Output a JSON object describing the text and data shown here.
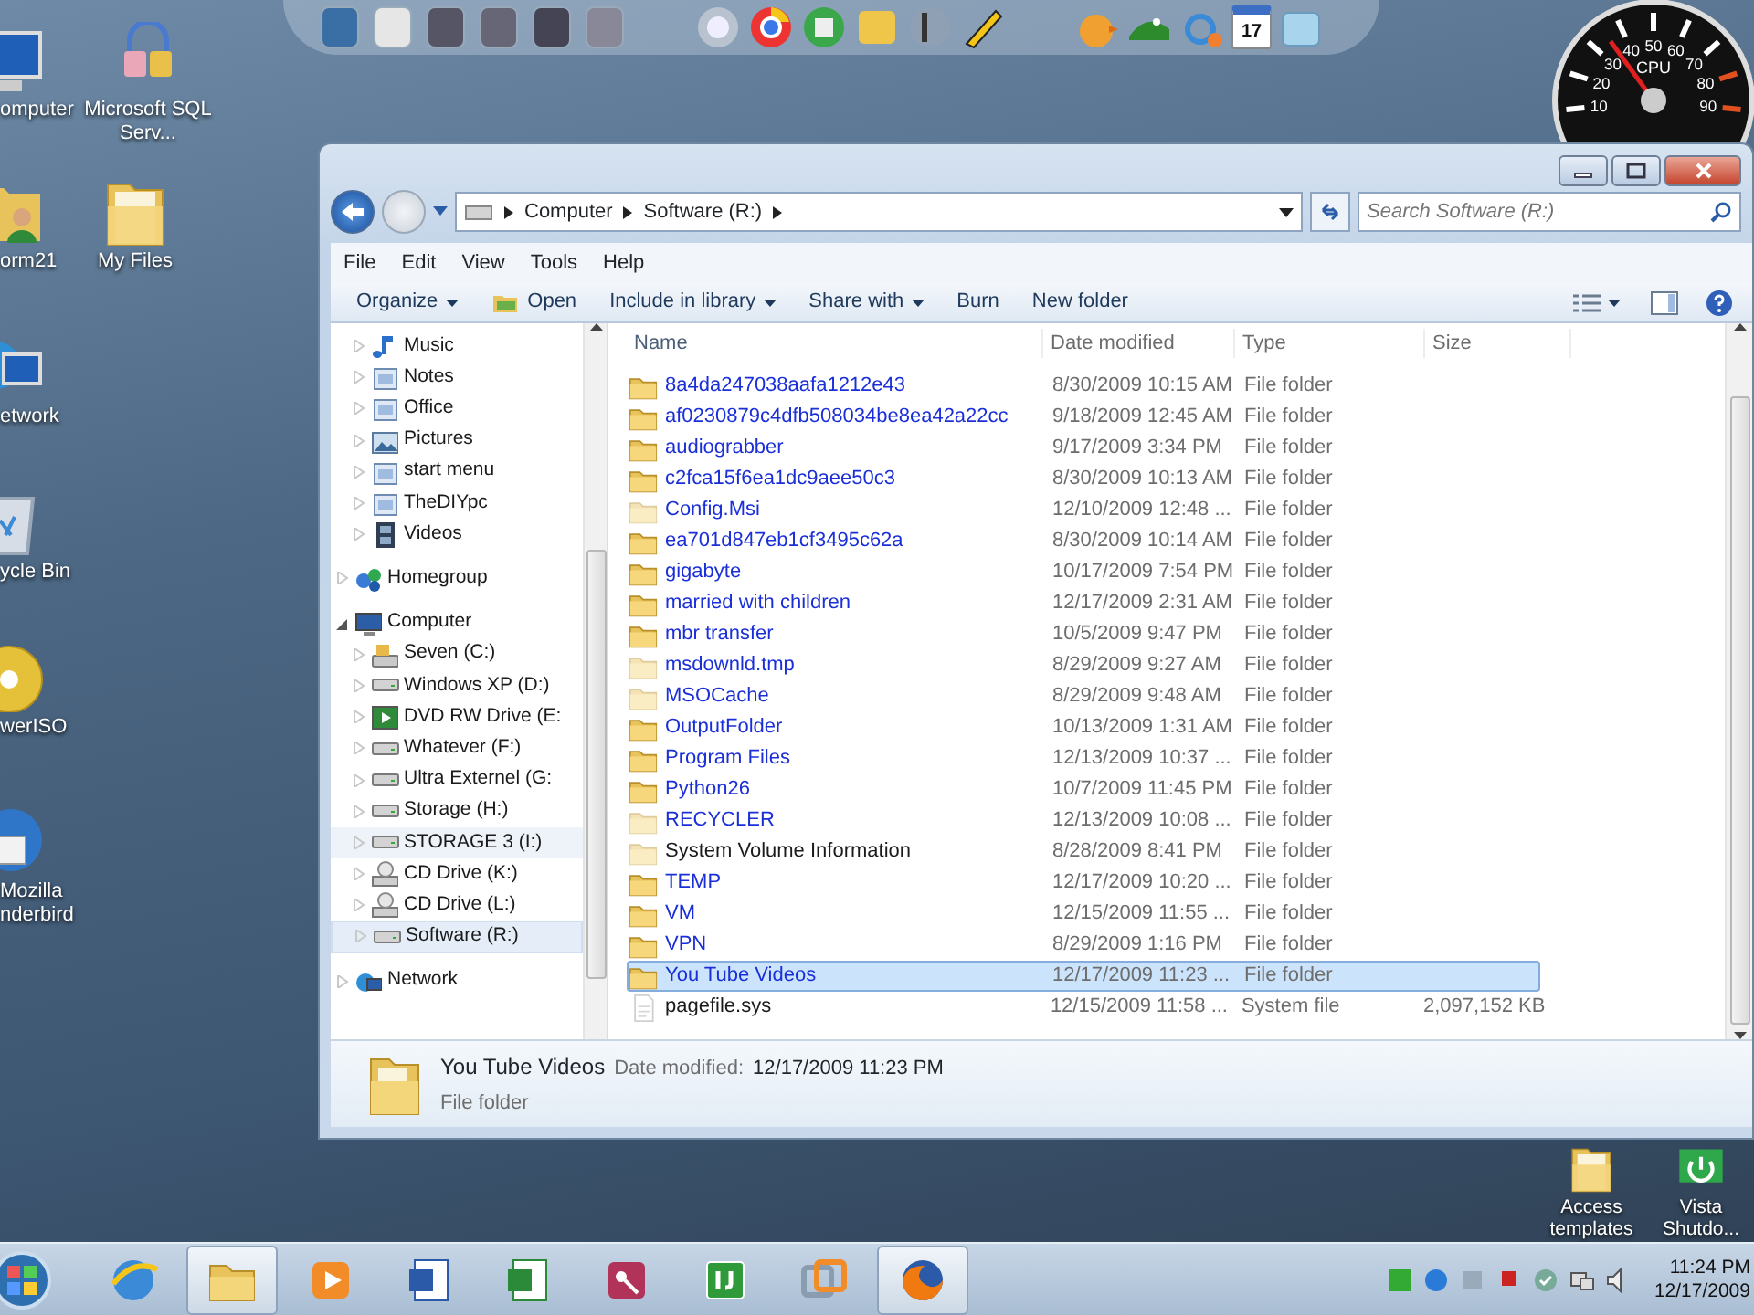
{
  "desktop": {
    "icons": [
      {
        "label": "omputer",
        "kind": "computer"
      },
      {
        "label": "Microsoft SQL Serv...",
        "kind": "database"
      },
      {
        "label": "orm21",
        "kind": "userfolder"
      },
      {
        "label": "My Files",
        "kind": "folder"
      },
      {
        "label": "etwork",
        "kind": "network"
      },
      {
        "label": "ycle Bin",
        "kind": "bin"
      },
      {
        "label": "werISO",
        "kind": "disc"
      },
      {
        "label": "Mozilla nderbird",
        "kind": "mail"
      },
      {
        "label": "Access templates",
        "kind": "folder"
      },
      {
        "label": "Vista Shutdo...",
        "kind": "shutdown"
      }
    ]
  },
  "dock": {
    "calendar_day": "17"
  },
  "cpu_gauge": {
    "label": "CPU",
    "ticks": [
      "10",
      "20",
      "30",
      "40",
      "50",
      "60",
      "70",
      "80",
      "90"
    ],
    "level": 0.35
  },
  "window": {
    "address": [
      "Computer",
      "Software (R:)"
    ],
    "search": {
      "placeholder": "Search Software (R:)"
    },
    "menu": [
      "File",
      "Edit",
      "View",
      "Tools",
      "Help"
    ],
    "toolbar": [
      {
        "label": "Organize",
        "kind": "menu"
      },
      {
        "label": "Open",
        "kind": "icon"
      },
      {
        "label": "Include in library",
        "kind": "menu"
      },
      {
        "label": "Share with",
        "kind": "menu"
      },
      {
        "label": "Burn",
        "kind": "plain"
      },
      {
        "label": "New folder",
        "kind": "plain"
      }
    ],
    "nav_tree": [
      {
        "children": [
          {
            "label": "Music",
            "kind": "music",
            "expanded": false,
            "selected": false,
            "hovered": false
          },
          {
            "label": "Notes",
            "kind": "library",
            "expanded": false,
            "selected": false,
            "hovered": false
          },
          {
            "label": "Office",
            "kind": "library",
            "expanded": false,
            "selected": false,
            "hovered": false
          },
          {
            "label": "Pictures",
            "kind": "pictures",
            "expanded": false,
            "selected": false,
            "hovered": false
          },
          {
            "label": "start menu",
            "kind": "library",
            "expanded": false,
            "selected": false,
            "hovered": false
          },
          {
            "label": "TheDIYpc",
            "kind": "library",
            "expanded": false,
            "selected": false,
            "hovered": false
          },
          {
            "label": "Videos",
            "kind": "videos",
            "expanded": false,
            "selected": false,
            "hovered": false
          }
        ]
      },
      {
        "label": "Homegroup",
        "kind": "homegroup",
        "expanded": false,
        "selected": false,
        "hovered": false
      },
      {
        "label": "Computer",
        "kind": "computer",
        "expanded": true,
        "selected": false,
        "hovered": false,
        "children": [
          {
            "label": "Seven (C:)",
            "kind": "sysdrive",
            "expanded": false,
            "selected": false,
            "hovered": false
          },
          {
            "label": "Windows XP (D:)",
            "kind": "drive",
            "expanded": false,
            "selected": false,
            "hovered": false
          },
          {
            "label": "DVD RW Drive (E:",
            "kind": "dvd",
            "expanded": false,
            "selected": false,
            "hovered": false
          },
          {
            "label": "Whatever (F:)",
            "kind": "drive",
            "expanded": false,
            "selected": false,
            "hovered": false
          },
          {
            "label": "Ultra Externel (G:",
            "kind": "drive",
            "expanded": false,
            "selected": false,
            "hovered": false
          },
          {
            "label": "Storage (H:)",
            "kind": "drive",
            "expanded": false,
            "selected": false,
            "hovered": false
          },
          {
            "label": "STORAGE 3 (I:)",
            "kind": "drive",
            "expanded": false,
            "selected": false,
            "hovered": true
          },
          {
            "label": "CD Drive (K:)",
            "kind": "cd",
            "expanded": false,
            "selected": false,
            "hovered": false
          },
          {
            "label": "CD Drive (L:)",
            "kind": "cd",
            "expanded": false,
            "selected": false,
            "hovered": false
          },
          {
            "label": "Software (R:)",
            "kind": "drive",
            "expanded": false,
            "selected": true,
            "hovered": false
          }
        ]
      },
      {
        "label": "Network",
        "kind": "network",
        "expanded": false,
        "selected": false,
        "hovered": false
      }
    ],
    "columns": [
      "Name",
      "Date modified",
      "Type",
      "Size"
    ],
    "rows": [
      {
        "name": "8a4da247038aafa1212e43",
        "date": "8/30/2009 10:15 AM",
        "type": "File folder",
        "kind": "folder",
        "hidden": false,
        "compressed": true,
        "selected": false
      },
      {
        "name": "af0230879c4dfb508034be8ea42a22cc",
        "date": "9/18/2009 12:45 AM",
        "type": "File folder",
        "kind": "folder",
        "hidden": false,
        "compressed": true,
        "selected": false
      },
      {
        "name": "audiograbber",
        "date": "9/17/2009 3:34 PM",
        "type": "File folder",
        "kind": "folder",
        "hidden": false,
        "compressed": true,
        "selected": false
      },
      {
        "name": "c2fca15f6ea1dc9aee50c3",
        "date": "8/30/2009 10:13 AM",
        "type": "File folder",
        "kind": "folder",
        "hidden": false,
        "compressed": true,
        "selected": false
      },
      {
        "name": "Config.Msi",
        "date": "12/10/2009 12:48 ...",
        "type": "File folder",
        "kind": "folder",
        "hidden": true,
        "compressed": true,
        "selected": false
      },
      {
        "name": "ea701d847eb1cf3495c62a",
        "date": "8/30/2009 10:14 AM",
        "type": "File folder",
        "kind": "folder",
        "hidden": false,
        "compressed": true,
        "selected": false
      },
      {
        "name": "gigabyte",
        "date": "10/17/2009 7:54 PM",
        "type": "File folder",
        "kind": "folder",
        "hidden": false,
        "compressed": true,
        "selected": false
      },
      {
        "name": "married with children",
        "date": "12/17/2009 2:31 AM",
        "type": "File folder",
        "kind": "folder",
        "hidden": false,
        "compressed": true,
        "selected": false
      },
      {
        "name": "mbr transfer",
        "date": "10/5/2009 9:47 PM",
        "type": "File folder",
        "kind": "folder",
        "hidden": false,
        "compressed": true,
        "selected": false
      },
      {
        "name": "msdownld.tmp",
        "date": "8/29/2009 9:27 AM",
        "type": "File folder",
        "kind": "folder",
        "hidden": true,
        "compressed": true,
        "selected": false
      },
      {
        "name": "MSOCache",
        "date": "8/29/2009 9:48 AM",
        "type": "File folder",
        "kind": "folder",
        "hidden": true,
        "compressed": true,
        "selected": false
      },
      {
        "name": "OutputFolder",
        "date": "10/13/2009 1:31 AM",
        "type": "File folder",
        "kind": "folder",
        "hidden": false,
        "compressed": true,
        "selected": false
      },
      {
        "name": "Program Files",
        "date": "12/13/2009 10:37 ...",
        "type": "File folder",
        "kind": "folder",
        "hidden": false,
        "compressed": true,
        "selected": false
      },
      {
        "name": "Python26",
        "date": "10/7/2009 11:45 PM",
        "type": "File folder",
        "kind": "folder",
        "hidden": false,
        "compressed": true,
        "selected": false
      },
      {
        "name": "RECYCLER",
        "date": "12/13/2009 10:08 ...",
        "type": "File folder",
        "kind": "folder",
        "hidden": true,
        "compressed": true,
        "selected": false
      },
      {
        "name": "System Volume Information",
        "date": "8/28/2009 8:41 PM",
        "type": "File folder",
        "kind": "folder",
        "hidden": true,
        "compressed": false,
        "selected": false
      },
      {
        "name": "TEMP",
        "date": "12/17/2009 10:20 ...",
        "type": "File folder",
        "kind": "folder",
        "hidden": false,
        "compressed": true,
        "selected": false
      },
      {
        "name": "VM",
        "date": "12/15/2009 11:55 ...",
        "type": "File folder",
        "kind": "folder",
        "hidden": false,
        "compressed": true,
        "selected": false
      },
      {
        "name": "VPN",
        "date": "8/29/2009 1:16 PM",
        "type": "File folder",
        "kind": "folder",
        "hidden": false,
        "compressed": true,
        "selected": false
      },
      {
        "name": "You Tube Videos",
        "date": "12/17/2009 11:23 ...",
        "type": "File folder",
        "kind": "folder",
        "hidden": false,
        "compressed": true,
        "selected": true
      },
      {
        "name": "pagefile.sys",
        "date": "12/15/2009 11:58 ...",
        "type": "System file",
        "size": "2,097,152 KB",
        "kind": "file",
        "hidden": true,
        "compressed": false,
        "selected": false
      }
    ],
    "details": {
      "name": "You Tube Videos",
      "date_label": "Date modified:",
      "date": "12/17/2009 11:23 PM",
      "type": "File folder"
    }
  },
  "taskbar": {
    "apps": [
      {
        "kind": "ie",
        "active": false
      },
      {
        "kind": "explorer",
        "active": true
      },
      {
        "kind": "media",
        "active": false
      },
      {
        "kind": "word",
        "active": false
      },
      {
        "kind": "excel",
        "active": false
      },
      {
        "kind": "access",
        "active": false
      },
      {
        "kind": "torrent",
        "active": false
      },
      {
        "kind": "vm",
        "active": false
      },
      {
        "kind": "firefox",
        "active": true
      }
    ],
    "clock": {
      "time": "11:24 PM",
      "date": "12/17/2009"
    }
  }
}
